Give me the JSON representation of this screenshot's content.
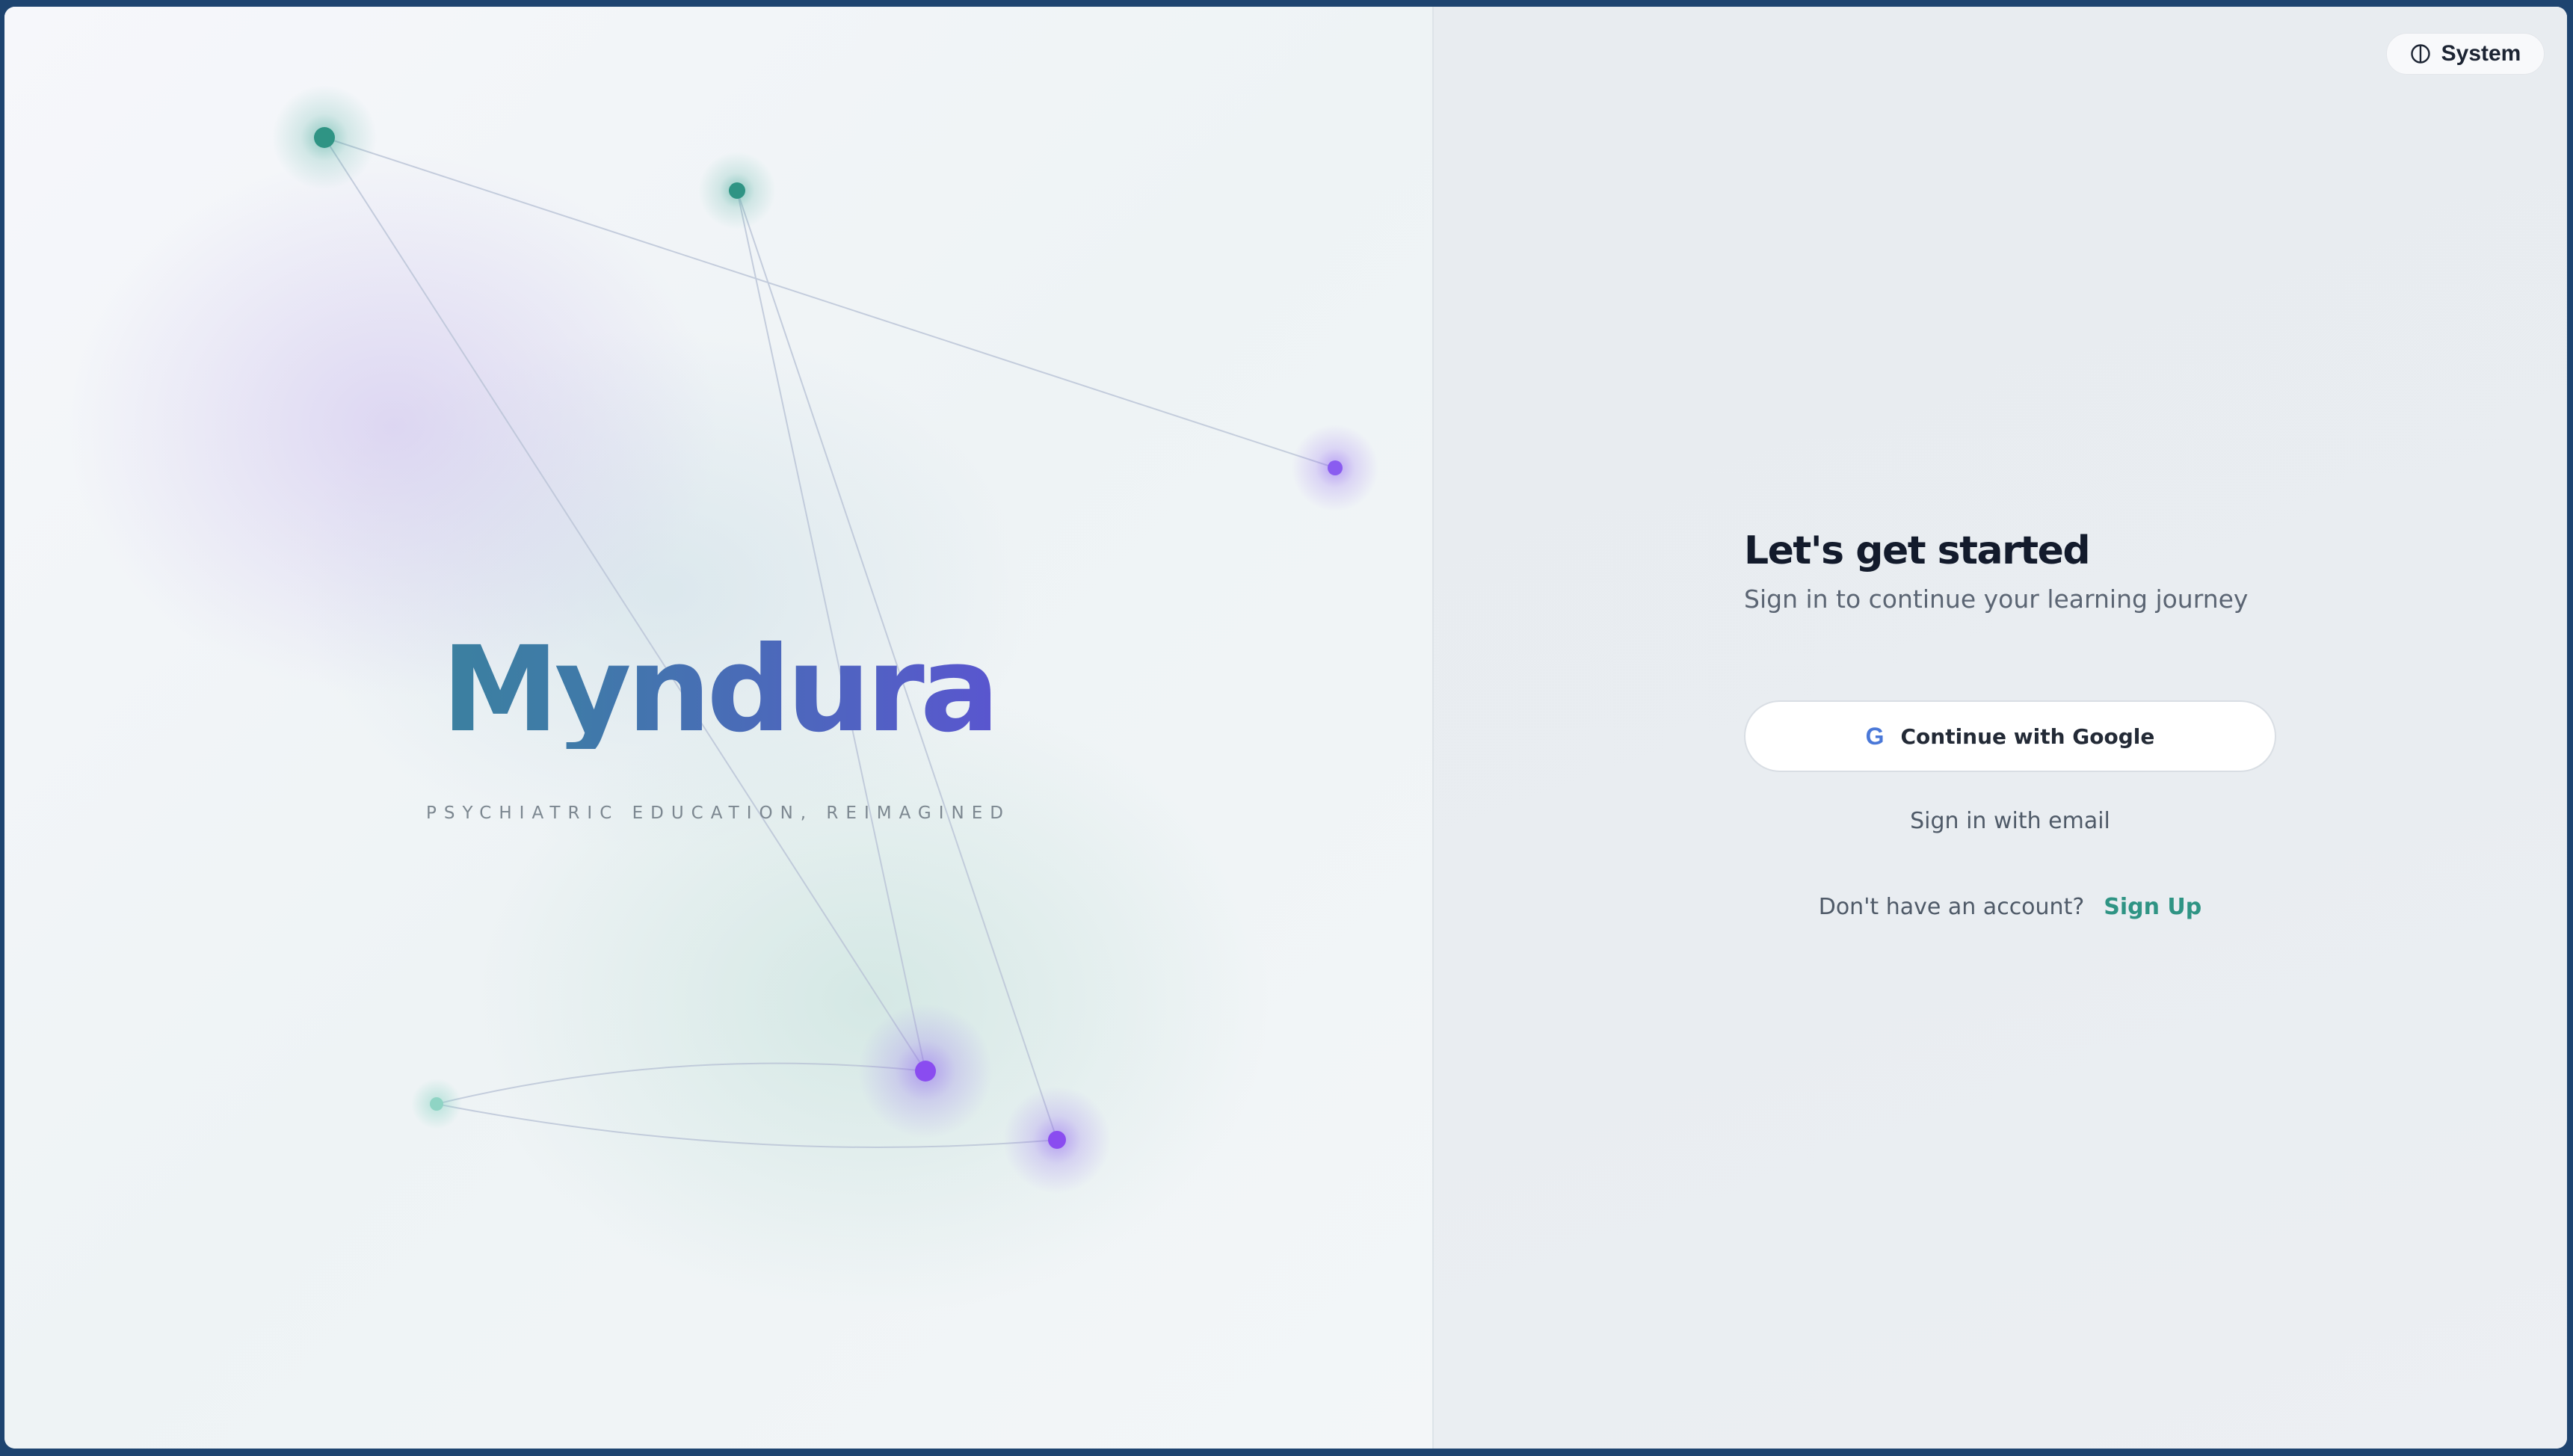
{
  "brand": {
    "name": "Myndura",
    "tagline": "PSYCHIATRIC EDUCATION, REIMAGINED"
  },
  "colors": {
    "teal_accent": "#2f9484",
    "purple_accent": "#7b45e6",
    "heading": "#131b2c",
    "frame": "#1e4470"
  },
  "theme_toggle": {
    "icon": "half-circle-theme-icon",
    "label": "System"
  },
  "auth": {
    "title": "Let's get started",
    "subtitle": "Sign in to continue your learning journey",
    "google_button": {
      "icon_glyph": "G",
      "icon": "google-icon",
      "label": "Continue with Google"
    },
    "email_link": "Sign in with email",
    "signup_prompt": "Don't have an account?",
    "signup_link": "Sign Up"
  }
}
